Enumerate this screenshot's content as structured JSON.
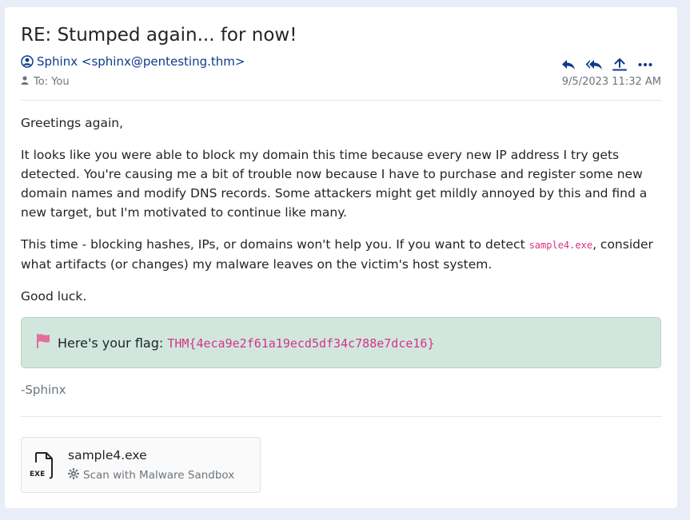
{
  "email": {
    "subject": "RE: Stumped again... for now!",
    "sender": "Sphinx <sphinx@pentesting.thm>",
    "to": "To: You",
    "date": "9/5/2023 11:32 AM",
    "greeting": "Greetings again,",
    "para1": "It looks like you were able to block my domain this time because every new IP address I try gets detected. You're causing me a bit of trouble now because I have to purchase and register some new domain names and modify DNS records. Some attackers might get mildly annoyed by this and find a new target, but I'm motivated to continue like many.",
    "para2_before": "This time - blocking hashes, IPs, or domains won't help you. If you want to detect ",
    "para2_code": "sample4.exe",
    "para2_after": ", consider what artifacts (or changes) my malware leaves on the victim's host system.",
    "closing": "Good luck.",
    "flag_label": "Here's your flag: ",
    "flag_value": "THM{4eca9e2f61a19ecd5df34c788e7dce16}",
    "signoff": "-Sphinx"
  },
  "actions": {
    "icons": [
      "reply-icon",
      "reply-all-icon",
      "forward-icon",
      "more-icon"
    ]
  },
  "attachment": {
    "filename": "sample4.exe",
    "file_type": "EXE",
    "scan_label": "Scan with Malware Sandbox"
  },
  "colors": {
    "accent": "#0d3b8c",
    "flag_bg": "#d1e7dd",
    "code": "#d63384",
    "flag_icon": "#e36d9d"
  }
}
